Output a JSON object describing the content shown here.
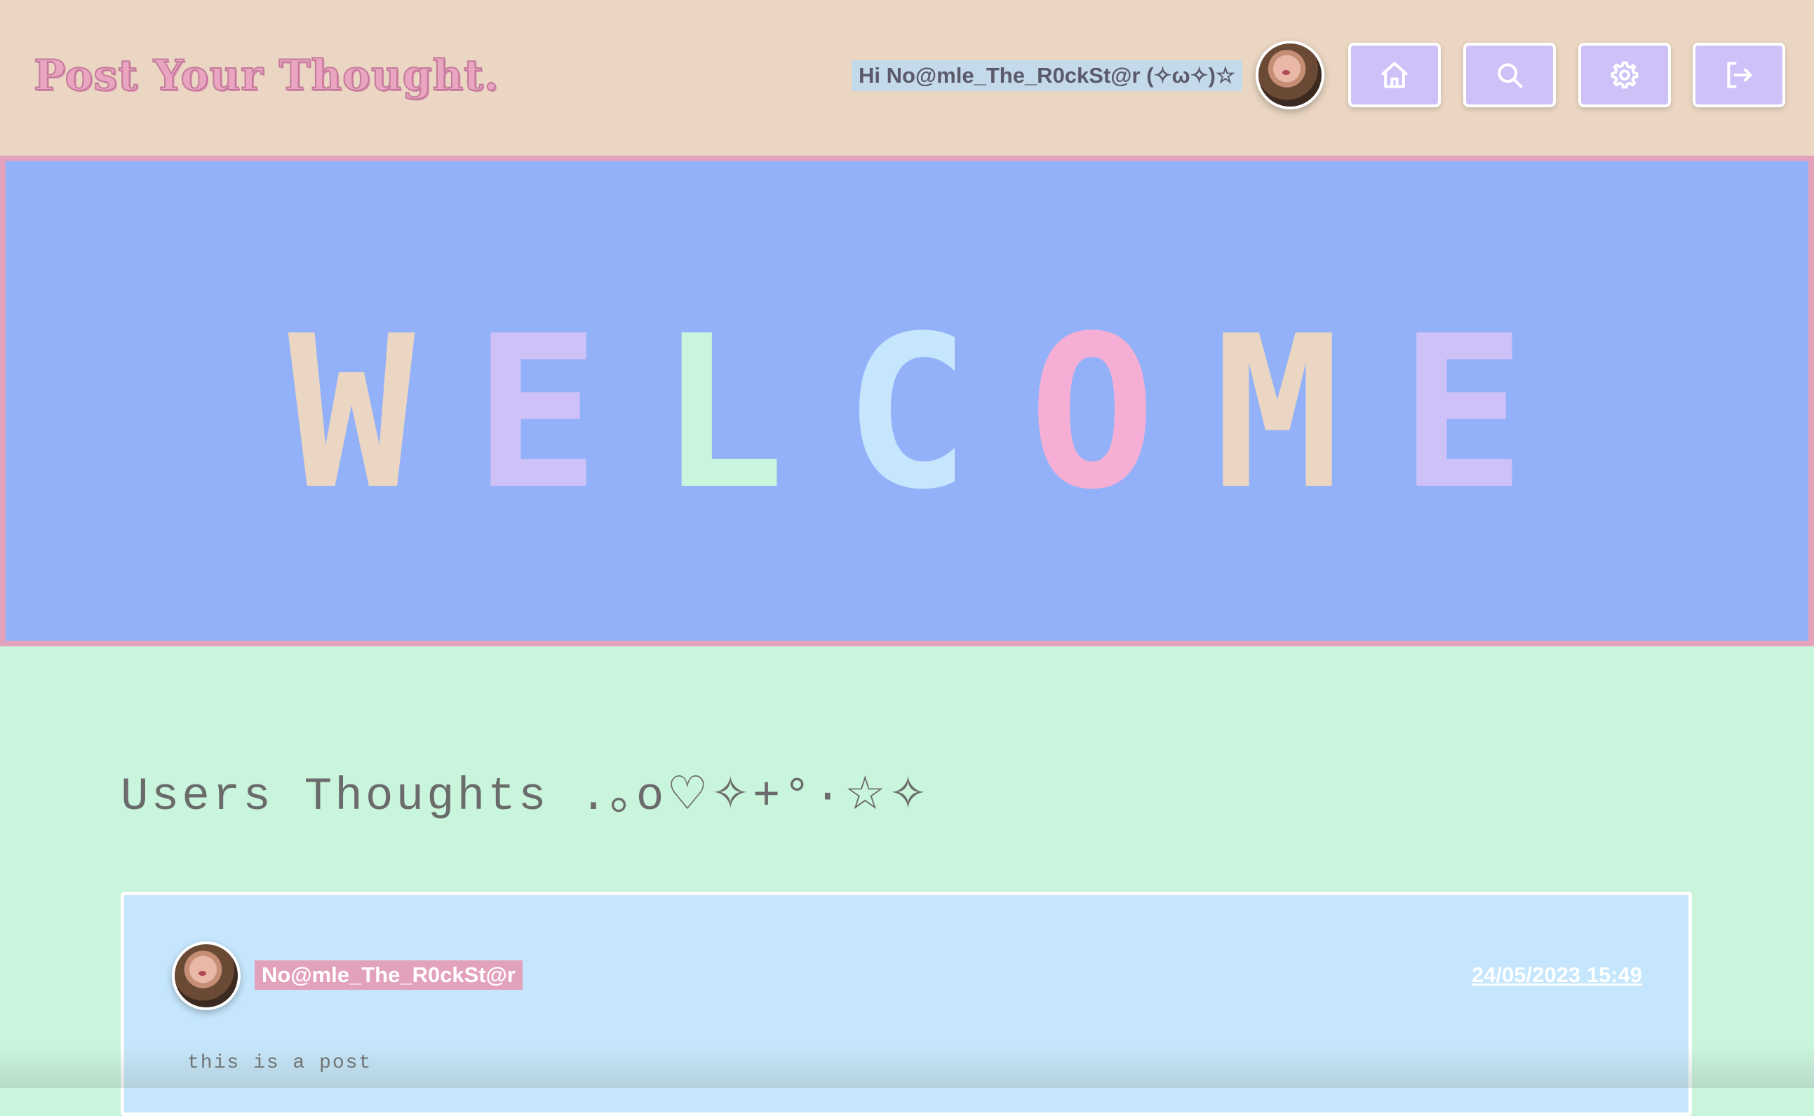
{
  "header": {
    "logo": "Post Your Thought.",
    "greeting": "Hi No@mle_The_R0ckSt@r (✧ω✧)☆",
    "avatar_alt": "user avatar",
    "nav": [
      {
        "label": "Home",
        "icon": "home-icon"
      },
      {
        "label": "Search",
        "icon": "search-icon"
      },
      {
        "label": "Settings",
        "icon": "gear-icon"
      },
      {
        "label": "Logout",
        "icon": "logout-icon"
      }
    ]
  },
  "banner": {
    "letters": [
      "W",
      "E",
      "L",
      "C",
      "O",
      "M",
      "E"
    ],
    "colors": [
      "#ead6c2",
      "#cdc1f7",
      "#caf5dd",
      "#c5e6fc",
      "#f5afd4",
      "#ead6c2",
      "#cdc1f7"
    ]
  },
  "section": {
    "title": "Users Thoughts .｡o♡✧+°·☆✧"
  },
  "posts": [
    {
      "username": "No@mle_The_R0ckSt@r",
      "date": "24/05/2023 15:49",
      "body": "this is a post"
    }
  ],
  "colors": {
    "header_bg": "#ead6c2",
    "banner_bg": "#93b1f8",
    "banner_border": "#e3a2bb",
    "page_bg": "#caf5dd",
    "card_bg": "#c5e6fc",
    "button_bg": "#cdc1f7",
    "accent_pink": "#e3a2bb"
  }
}
